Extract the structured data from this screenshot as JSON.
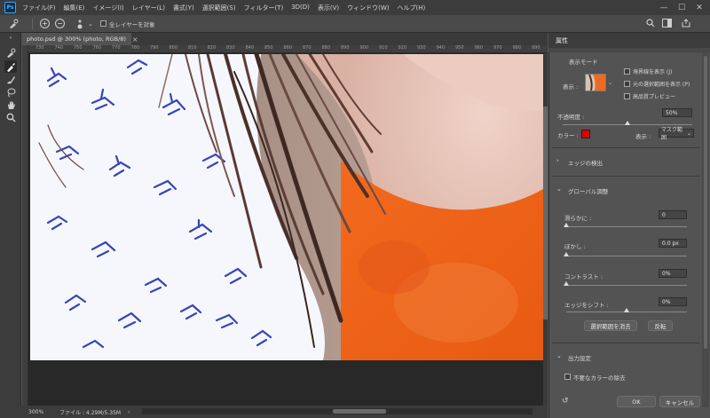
{
  "app": {
    "logo": "Ps"
  },
  "menu": [
    "ファイル(F)",
    "編集(E)",
    "イメージ(I)",
    "レイヤー(L)",
    "書式(Y)",
    "選択範囲(S)",
    "フィルター(T)",
    "3D(D)",
    "表示(V)",
    "ウィンドウ(W)",
    "ヘルプ(H)"
  ],
  "window_controls": {
    "minimize": "—",
    "maximize": "☐",
    "close": "✕"
  },
  "options": {
    "all_layers_label": "全レイヤーを対象"
  },
  "document": {
    "tab_title": "photo.psd @ 300% (photo, RGB/8)",
    "ruler_marks": [
      "730",
      "740",
      "750",
      "760",
      "770",
      "780",
      "790",
      "800",
      "810",
      "820",
      "830",
      "840",
      "850",
      "860",
      "870",
      "880",
      "890",
      "900",
      "910",
      "920",
      "930",
      "940",
      "950",
      "960",
      "970",
      "980",
      "990"
    ]
  },
  "status": {
    "zoom": "300%",
    "file_info": "ファイル : 4.29M/5.35M"
  },
  "panel": {
    "title": "属性",
    "view_mode": {
      "section": "表示モード",
      "view_label": "表示 :",
      "checkbox_show_edge": "境界線を表示 (J)",
      "checkbox_show_original": "元の選択範囲を表示 (P)",
      "checkbox_hq_preview": "高品質プレビュー"
    },
    "opacity": {
      "label": "不透明度 :",
      "value": "50%",
      "level": 0.5
    },
    "color": {
      "label": "カラー :",
      "swatch": "#e00000",
      "display_label": "表示 :",
      "display_value": "マスク範囲"
    },
    "edge_detection": {
      "label": "エッジの検出",
      "state": "collapsed"
    },
    "global_refine": {
      "label": "グローバル調整",
      "state": "expanded",
      "smooth": {
        "label": "滑らかに :",
        "value": "0",
        "level": 0
      },
      "feather": {
        "label": "ぼかし :",
        "value": "0.0 px",
        "level": 0
      },
      "contrast": {
        "label": "コントラスト :",
        "value": "0%",
        "level": 0
      },
      "shift_edge": {
        "label": "エッジをシフト :",
        "value": "0%",
        "level": 0.5
      },
      "clear_selection": "選択範囲を消去",
      "invert": "反転"
    },
    "output": {
      "label": "出力設定",
      "decontaminate": "不要なカラーの除去"
    },
    "ok": "OK",
    "cancel": "キャンセル"
  }
}
